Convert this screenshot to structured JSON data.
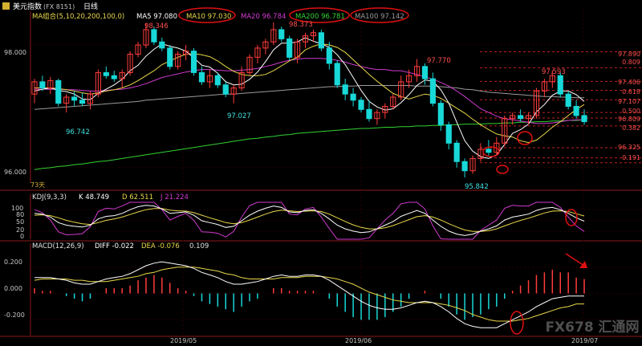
{
  "header": {
    "icon": "usd-index-icon",
    "title": "美元指数",
    "code": "(FX 8151)",
    "period": "日线"
  },
  "legend_ma": {
    "label": "MA组合(5,10,20,200,100,0)",
    "items": [
      {
        "text": "MA5 97.080",
        "color": "#ffffff"
      },
      {
        "text": "MA10 97.030",
        "color": "#e8d84a"
      },
      {
        "text": "MA20 96.784",
        "color": "#d03ad0"
      },
      {
        "text": "MA200 96.781",
        "color": "#32d232"
      },
      {
        "text": "MA100 97.142",
        "color": "#9a9a9a"
      }
    ]
  },
  "legend_kdj": {
    "label": "KDJ(9,3,3)",
    "items": [
      {
        "text": "K 48.749",
        "color": "#ffffff"
      },
      {
        "text": "D 62.511",
        "color": "#e8d84a"
      },
      {
        "text": "J 21.224",
        "color": "#d03ad0"
      }
    ]
  },
  "legend_macd": {
    "label": "MACD(12,26,9)",
    "items": [
      {
        "text": "DIFF -0.022",
        "color": "#ffffff"
      },
      {
        "text": "DEA -0.076",
        "color": "#e8d84a"
      },
      {
        "text": "0.109",
        "color": "#e0e0e0"
      }
    ]
  },
  "price_axis": [
    "98.000",
    "96.000"
  ],
  "kdj_axis": [
    "100",
    "80",
    "50",
    "20",
    "0"
  ],
  "macd_axis": [
    "0.200",
    "0.000",
    "-0.200"
  ],
  "date_axis": [
    "2019/05",
    "2019/06",
    "2019/07"
  ],
  "count_label": "73天",
  "price_annotations": [
    "98.346",
    "98.373",
    "97.770",
    "97.593",
    "96.742",
    "97.027",
    "95.842"
  ],
  "fib_levels": [
    {
      "label": "97.890",
      "value": 97.89
    },
    {
      "label": "0.809",
      "value": 97.63
    },
    {
      "label": "97.406",
      "value": 97.406
    },
    {
      "label": "0.618",
      "value": 97.26
    },
    {
      "label": "97.107",
      "value": 97.107
    },
    {
      "label": "0.500",
      "value": 96.9
    },
    {
      "label": "96.809",
      "value": 96.809
    },
    {
      "label": "0.382",
      "value": 96.68
    },
    {
      "label": "96.325",
      "value": 96.325
    },
    {
      "label": "0.191",
      "value": 96.16
    }
  ],
  "watermark": "FX678 汇通网",
  "colors": {
    "up": "#ff3c3c",
    "down": "#18d8d8",
    "grid": "#2a0000",
    "axis": "#8a1a1a",
    "ma5": "#ffffff",
    "ma10": "#e8d84a",
    "ma20": "#d03ad0",
    "ma100": "#9a9a9a",
    "ma200": "#32d232",
    "label_red": "#ff5050",
    "label_cyan": "#40e0e0",
    "circle": "#e01010"
  },
  "chart_data": {
    "type": "candlestick",
    "ylim": [
      95.75,
      98.55
    ],
    "ohlc": [
      [
        97.2,
        97.45,
        97.05,
        97.4
      ],
      [
        97.4,
        97.5,
        97.25,
        97.3
      ],
      [
        97.3,
        97.48,
        97.2,
        97.42
      ],
      [
        97.42,
        97.45,
        97.0,
        97.05
      ],
      [
        97.05,
        97.2,
        96.9,
        97.15
      ],
      [
        97.15,
        97.25,
        97.0,
        97.1
      ],
      [
        97.1,
        97.22,
        97.0,
        97.05
      ],
      [
        97.05,
        97.25,
        96.95,
        97.2
      ],
      [
        97.2,
        97.6,
        97.15,
        97.55
      ],
      [
        97.55,
        97.65,
        97.45,
        97.5
      ],
      [
        97.5,
        97.58,
        97.4,
        97.45
      ],
      [
        97.45,
        97.6,
        97.3,
        97.55
      ],
      [
        97.55,
        97.9,
        97.5,
        97.85
      ],
      [
        97.85,
        98.05,
        97.8,
        98.0
      ],
      [
        98.0,
        98.35,
        97.95,
        98.25
      ],
      [
        98.25,
        98.3,
        98.0,
        98.05
      ],
      [
        98.05,
        98.12,
        97.9,
        97.95
      ],
      [
        97.95,
        98.0,
        97.6,
        97.65
      ],
      [
        97.65,
        97.9,
        97.6,
        97.85
      ],
      [
        97.85,
        98.0,
        97.75,
        97.9
      ],
      [
        97.9,
        97.95,
        97.5,
        97.55
      ],
      [
        97.55,
        97.65,
        97.35,
        97.4
      ],
      [
        97.4,
        97.6,
        97.3,
        97.5
      ],
      [
        97.5,
        97.55,
        97.3,
        97.35
      ],
      [
        97.35,
        97.4,
        97.15,
        97.2
      ],
      [
        97.2,
        97.35,
        97.05,
        97.3
      ],
      [
        97.3,
        97.65,
        97.25,
        97.55
      ],
      [
        97.55,
        97.85,
        97.5,
        97.8
      ],
      [
        97.8,
        98.0,
        97.7,
        97.95
      ],
      [
        97.95,
        98.1,
        97.85,
        98.05
      ],
      [
        98.05,
        98.37,
        98.0,
        98.25
      ],
      [
        98.25,
        98.3,
        98.05,
        98.1
      ],
      [
        98.1,
        98.15,
        97.75,
        97.8
      ],
      [
        97.8,
        98.1,
        97.7,
        98.05
      ],
      [
        98.05,
        98.2,
        97.95,
        98.15
      ],
      [
        98.15,
        98.25,
        98.05,
        98.2
      ],
      [
        98.2,
        98.25,
        97.9,
        97.95
      ],
      [
        97.95,
        98.05,
        97.6,
        97.7
      ],
      [
        97.7,
        97.75,
        97.3,
        97.35
      ],
      [
        97.35,
        97.45,
        97.1,
        97.2
      ],
      [
        97.2,
        97.3,
        97.0,
        97.1
      ],
      [
        97.1,
        97.15,
        96.9,
        96.95
      ],
      [
        96.95,
        97.1,
        96.75,
        96.8
      ],
      [
        96.8,
        96.95,
        96.7,
        96.9
      ],
      [
        96.9,
        97.05,
        96.8,
        97.0
      ],
      [
        97.0,
        97.2,
        96.95,
        97.15
      ],
      [
        97.15,
        97.5,
        97.1,
        97.4
      ],
      [
        97.4,
        97.6,
        97.3,
        97.5
      ],
      [
        97.5,
        97.77,
        97.4,
        97.65
      ],
      [
        97.65,
        97.7,
        97.35,
        97.45
      ],
      [
        97.45,
        97.55,
        97.0,
        97.05
      ],
      [
        97.05,
        97.1,
        96.6,
        96.7
      ],
      [
        96.7,
        96.75,
        96.3,
        96.4
      ],
      [
        96.4,
        96.45,
        96.0,
        96.1
      ],
      [
        96.1,
        96.15,
        95.84,
        95.95
      ],
      [
        95.95,
        96.2,
        95.9,
        96.15
      ],
      [
        96.15,
        96.4,
        96.1,
        96.3
      ],
      [
        96.3,
        96.45,
        96.2,
        96.25
      ],
      [
        96.25,
        96.5,
        96.2,
        96.4
      ],
      [
        96.4,
        96.85,
        96.35,
        96.8
      ],
      [
        96.8,
        96.9,
        96.7,
        96.85
      ],
      [
        96.85,
        96.95,
        96.75,
        96.8
      ],
      [
        96.8,
        96.9,
        96.7,
        96.85
      ],
      [
        96.85,
        97.3,
        96.8,
        97.25
      ],
      [
        97.25,
        97.45,
        97.15,
        97.4
      ],
      [
        97.4,
        97.59,
        97.3,
        97.5
      ],
      [
        97.5,
        97.55,
        97.15,
        97.2
      ],
      [
        97.2,
        97.25,
        96.95,
        97.0
      ],
      [
        97.0,
        97.1,
        96.8,
        96.85
      ],
      [
        96.85,
        96.95,
        96.7,
        96.75
      ]
    ],
    "ma5": [
      97.25,
      97.28,
      97.3,
      97.26,
      97.24,
      97.2,
      97.12,
      97.11,
      97.21,
      97.28,
      97.35,
      97.44,
      97.58,
      97.67,
      97.82,
      97.93,
      98.02,
      97.98,
      97.95,
      97.9,
      97.79,
      97.67,
      97.64,
      97.54,
      97.4,
      97.35,
      97.36,
      97.44,
      97.56,
      97.73,
      97.92,
      98.03,
      98.03,
      98.05,
      98.12,
      98.06,
      98.02,
      97.96,
      97.84,
      97.68,
      97.47,
      97.26,
      97.08,
      96.99,
      96.94,
      96.96,
      97.06,
      97.19,
      97.34,
      97.43,
      97.41,
      97.27,
      97.05,
      96.74,
      96.44,
      96.27,
      96.18,
      96.15,
      96.21,
      96.38,
      96.56,
      96.62,
      96.71,
      96.91,
      97.03,
      97.18,
      97.25,
      97.25,
      97.19,
      97.08
    ],
    "ma10": [
      97.3,
      97.3,
      97.3,
      97.29,
      97.27,
      97.25,
      97.22,
      97.2,
      97.22,
      97.25,
      97.27,
      97.3,
      97.35,
      97.42,
      97.5,
      97.58,
      97.68,
      97.74,
      97.8,
      97.85,
      97.86,
      97.84,
      97.81,
      97.74,
      97.65,
      97.57,
      97.52,
      97.5,
      97.5,
      97.52,
      97.58,
      97.66,
      97.74,
      97.8,
      97.92,
      97.98,
      98.02,
      98.0,
      97.96,
      97.88,
      97.76,
      97.64,
      97.52,
      97.41,
      97.31,
      97.21,
      97.16,
      97.12,
      97.16,
      97.2,
      97.18,
      97.13,
      97.05,
      96.97,
      96.89,
      96.79,
      96.7,
      96.62,
      96.55,
      96.52,
      96.5,
      96.44,
      96.41,
      96.45,
      96.55,
      96.66,
      96.75,
      96.85,
      96.95,
      97.03
    ],
    "ma20": [
      97.28,
      97.28,
      97.28,
      97.28,
      97.27,
      97.27,
      97.26,
      97.25,
      97.25,
      97.26,
      97.27,
      97.28,
      97.3,
      97.33,
      97.37,
      97.42,
      97.47,
      97.5,
      97.53,
      97.56,
      97.58,
      97.6,
      97.6,
      97.59,
      97.58,
      97.58,
      97.59,
      97.6,
      97.62,
      97.65,
      97.68,
      97.72,
      97.75,
      97.77,
      97.78,
      97.78,
      97.78,
      97.77,
      97.75,
      97.72,
      97.68,
      97.65,
      97.62,
      97.6,
      97.6,
      97.58,
      97.58,
      97.55,
      97.52,
      97.48,
      97.44,
      97.39,
      97.33,
      97.25,
      97.16,
      97.06,
      96.96,
      96.9,
      96.84,
      96.8,
      96.78,
      96.76,
      96.74,
      96.72,
      96.72,
      96.73,
      96.75,
      96.77,
      96.78,
      96.78
    ],
    "ma100": [
      96.95,
      96.96,
      96.97,
      96.98,
      96.99,
      97.0,
      97.01,
      97.02,
      97.03,
      97.04,
      97.05,
      97.06,
      97.07,
      97.08,
      97.1,
      97.11,
      97.12,
      97.13,
      97.14,
      97.15,
      97.16,
      97.17,
      97.18,
      97.19,
      97.2,
      97.2,
      97.21,
      97.22,
      97.23,
      97.24,
      97.25,
      97.26,
      97.27,
      97.28,
      97.29,
      97.3,
      97.31,
      97.32,
      97.32,
      97.33,
      97.33,
      97.34,
      97.34,
      97.34,
      97.34,
      97.34,
      97.34,
      97.34,
      97.33,
      97.33,
      97.33,
      97.32,
      97.31,
      97.3,
      97.28,
      97.27,
      97.25,
      97.23,
      97.22,
      97.21,
      97.2,
      97.19,
      97.18,
      97.17,
      97.16,
      97.16,
      97.15,
      97.15,
      97.14,
      97.14
    ],
    "ma200": [
      95.97,
      95.99,
      96.0,
      96.02,
      96.03,
      96.05,
      96.06,
      96.08,
      96.1,
      96.11,
      96.13,
      96.15,
      96.17,
      96.19,
      96.21,
      96.23,
      96.25,
      96.27,
      96.29,
      96.31,
      96.33,
      96.35,
      96.37,
      96.39,
      96.41,
      96.43,
      96.45,
      96.47,
      96.48,
      96.5,
      96.51,
      96.53,
      96.54,
      96.56,
      96.57,
      96.58,
      96.59,
      96.6,
      96.61,
      96.62,
      96.63,
      96.64,
      96.64,
      96.65,
      96.66,
      96.66,
      96.67,
      96.67,
      96.68,
      96.68,
      96.69,
      96.69,
      96.7,
      96.7,
      96.71,
      96.71,
      96.71,
      96.72,
      96.72,
      96.73,
      96.73,
      96.74,
      96.74,
      96.75,
      96.75,
      96.76,
      96.76,
      96.77,
      96.77,
      96.78
    ],
    "kdj": {
      "ylim": [
        0,
        100
      ],
      "k": [
        70,
        68,
        60,
        45,
        38,
        35,
        33,
        38,
        55,
        62,
        64,
        70,
        80,
        88,
        92,
        90,
        82,
        70,
        72,
        74,
        65,
        50,
        45,
        40,
        32,
        35,
        50,
        65,
        76,
        84,
        90,
        86,
        74,
        72,
        78,
        80,
        70,
        55,
        38,
        28,
        22,
        18,
        20,
        28,
        38,
        48,
        62,
        70,
        78,
        70,
        52,
        35,
        22,
        14,
        10,
        14,
        22,
        28,
        36,
        52,
        60,
        64,
        68,
        78,
        84,
        86,
        80,
        70,
        58,
        49
      ],
      "d": [
        65,
        66,
        64,
        58,
        51,
        46,
        42,
        40,
        45,
        51,
        55,
        60,
        67,
        74,
        80,
        83,
        83,
        79,
        77,
        76,
        72,
        65,
        58,
        52,
        45,
        42,
        45,
        52,
        60,
        68,
        75,
        79,
        77,
        75,
        76,
        77,
        75,
        68,
        58,
        48,
        39,
        32,
        28,
        28,
        31,
        37,
        45,
        53,
        61,
        64,
        60,
        52,
        42,
        33,
        25,
        21,
        21,
        23,
        28,
        36,
        44,
        51,
        57,
        64,
        71,
        76,
        77,
        75,
        69,
        63
      ],
      "j": [
        80,
        72,
        52,
        20,
        12,
        13,
        15,
        34,
        75,
        84,
        82,
        90,
        100,
        100,
        100,
        100,
        80,
        52,
        62,
        70,
        51,
        20,
        19,
        16,
        6,
        21,
        60,
        91,
        100,
        100,
        100,
        100,
        68,
        66,
        82,
        86,
        60,
        29,
        0,
        0,
        0,
        0,
        4,
        28,
        52,
        70,
        96,
        100,
        100,
        82,
        36,
        1,
        0,
        0,
        0,
        0,
        24,
        38,
        52,
        84,
        92,
        90,
        90,
        100,
        100,
        100,
        86,
        60,
        36,
        21
      ]
    },
    "macd": {
      "ylim": [
        -0.32,
        0.32
      ],
      "diff": [
        0.12,
        0.12,
        0.12,
        0.11,
        0.1,
        0.08,
        0.07,
        0.07,
        0.09,
        0.11,
        0.12,
        0.13,
        0.15,
        0.18,
        0.21,
        0.23,
        0.24,
        0.23,
        0.22,
        0.21,
        0.19,
        0.16,
        0.14,
        0.12,
        0.09,
        0.07,
        0.07,
        0.08,
        0.09,
        0.11,
        0.13,
        0.14,
        0.13,
        0.13,
        0.14,
        0.14,
        0.13,
        0.1,
        0.06,
        0.02,
        -0.02,
        -0.06,
        -0.09,
        -0.11,
        -0.12,
        -0.12,
        -0.11,
        -0.09,
        -0.07,
        -0.06,
        -0.07,
        -0.1,
        -0.14,
        -0.19,
        -0.23,
        -0.25,
        -0.26,
        -0.26,
        -0.26,
        -0.23,
        -0.2,
        -0.17,
        -0.14,
        -0.1,
        -0.07,
        -0.04,
        -0.03,
        -0.02,
        -0.02,
        -0.02
      ],
      "dea": [
        0.1,
        0.11,
        0.11,
        0.11,
        0.11,
        0.1,
        0.1,
        0.09,
        0.09,
        0.09,
        0.1,
        0.11,
        0.12,
        0.13,
        0.15,
        0.16,
        0.18,
        0.19,
        0.2,
        0.2,
        0.2,
        0.19,
        0.18,
        0.17,
        0.15,
        0.14,
        0.12,
        0.11,
        0.11,
        0.11,
        0.11,
        0.12,
        0.12,
        0.12,
        0.13,
        0.13,
        0.13,
        0.12,
        0.11,
        0.09,
        0.07,
        0.04,
        0.01,
        -0.01,
        -0.03,
        -0.05,
        -0.06,
        -0.07,
        -0.07,
        -0.07,
        -0.07,
        -0.08,
        -0.09,
        -0.11,
        -0.13,
        -0.16,
        -0.18,
        -0.2,
        -0.21,
        -0.21,
        -0.21,
        -0.2,
        -0.19,
        -0.17,
        -0.15,
        -0.13,
        -0.11,
        -0.1,
        -0.08,
        -0.08
      ],
      "hist": [
        0.04,
        0.02,
        0.02,
        0.0,
        -0.02,
        -0.04,
        -0.06,
        -0.04,
        0.0,
        0.04,
        0.04,
        0.04,
        0.06,
        0.1,
        0.12,
        0.14,
        0.12,
        0.08,
        0.04,
        0.02,
        -0.02,
        -0.06,
        -0.08,
        -0.1,
        -0.12,
        -0.14,
        -0.1,
        -0.06,
        -0.04,
        0.0,
        0.04,
        0.04,
        0.02,
        0.02,
        0.02,
        0.02,
        0.0,
        -0.04,
        -0.1,
        -0.14,
        -0.18,
        -0.2,
        -0.2,
        -0.2,
        -0.18,
        -0.14,
        -0.1,
        -0.04,
        0.0,
        0.02,
        0.0,
        -0.04,
        -0.1,
        -0.16,
        -0.2,
        -0.18,
        -0.16,
        -0.12,
        -0.1,
        -0.04,
        0.02,
        0.06,
        0.1,
        0.14,
        0.16,
        0.18,
        0.16,
        0.16,
        0.12,
        0.109
      ]
    }
  }
}
